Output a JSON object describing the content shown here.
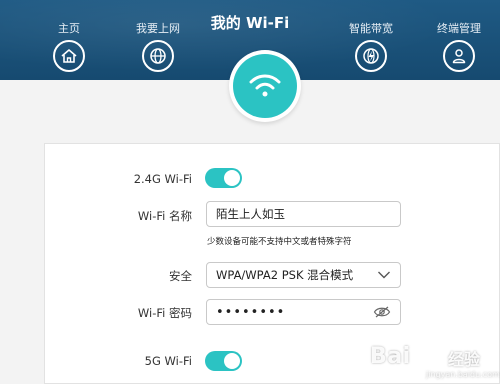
{
  "nav": {
    "title": "我的 Wi-Fi",
    "items": [
      {
        "label": "主页",
        "icon": "home-icon"
      },
      {
        "label": "我要上网",
        "icon": "globe-icon"
      },
      {
        "label": "智能带宽",
        "icon": "bandwidth-icon"
      },
      {
        "label": "终端管理",
        "icon": "user-icon"
      }
    ],
    "hub_icon": "wifi-icon"
  },
  "wifi24": {
    "label": "2.4G Wi-Fi",
    "enabled": true,
    "name_label": "Wi-Fi 名称",
    "name_value": "陌生上人如玉",
    "name_hint": "少数设备可能不支持中文或者特殊字符",
    "security_label": "安全",
    "security_value": "WPA/WPA2 PSK 混合模式",
    "password_label": "Wi-Fi 密码",
    "password_value": "••••••••"
  },
  "wifi5": {
    "label": "5G Wi-Fi",
    "enabled": true
  },
  "watermark": {
    "main": "Bai",
    "cn": "经验",
    "url": "jingyan.baidu.com"
  },
  "colors": {
    "nav_bg": "#1a5179",
    "accent": "#2bc3c3"
  }
}
